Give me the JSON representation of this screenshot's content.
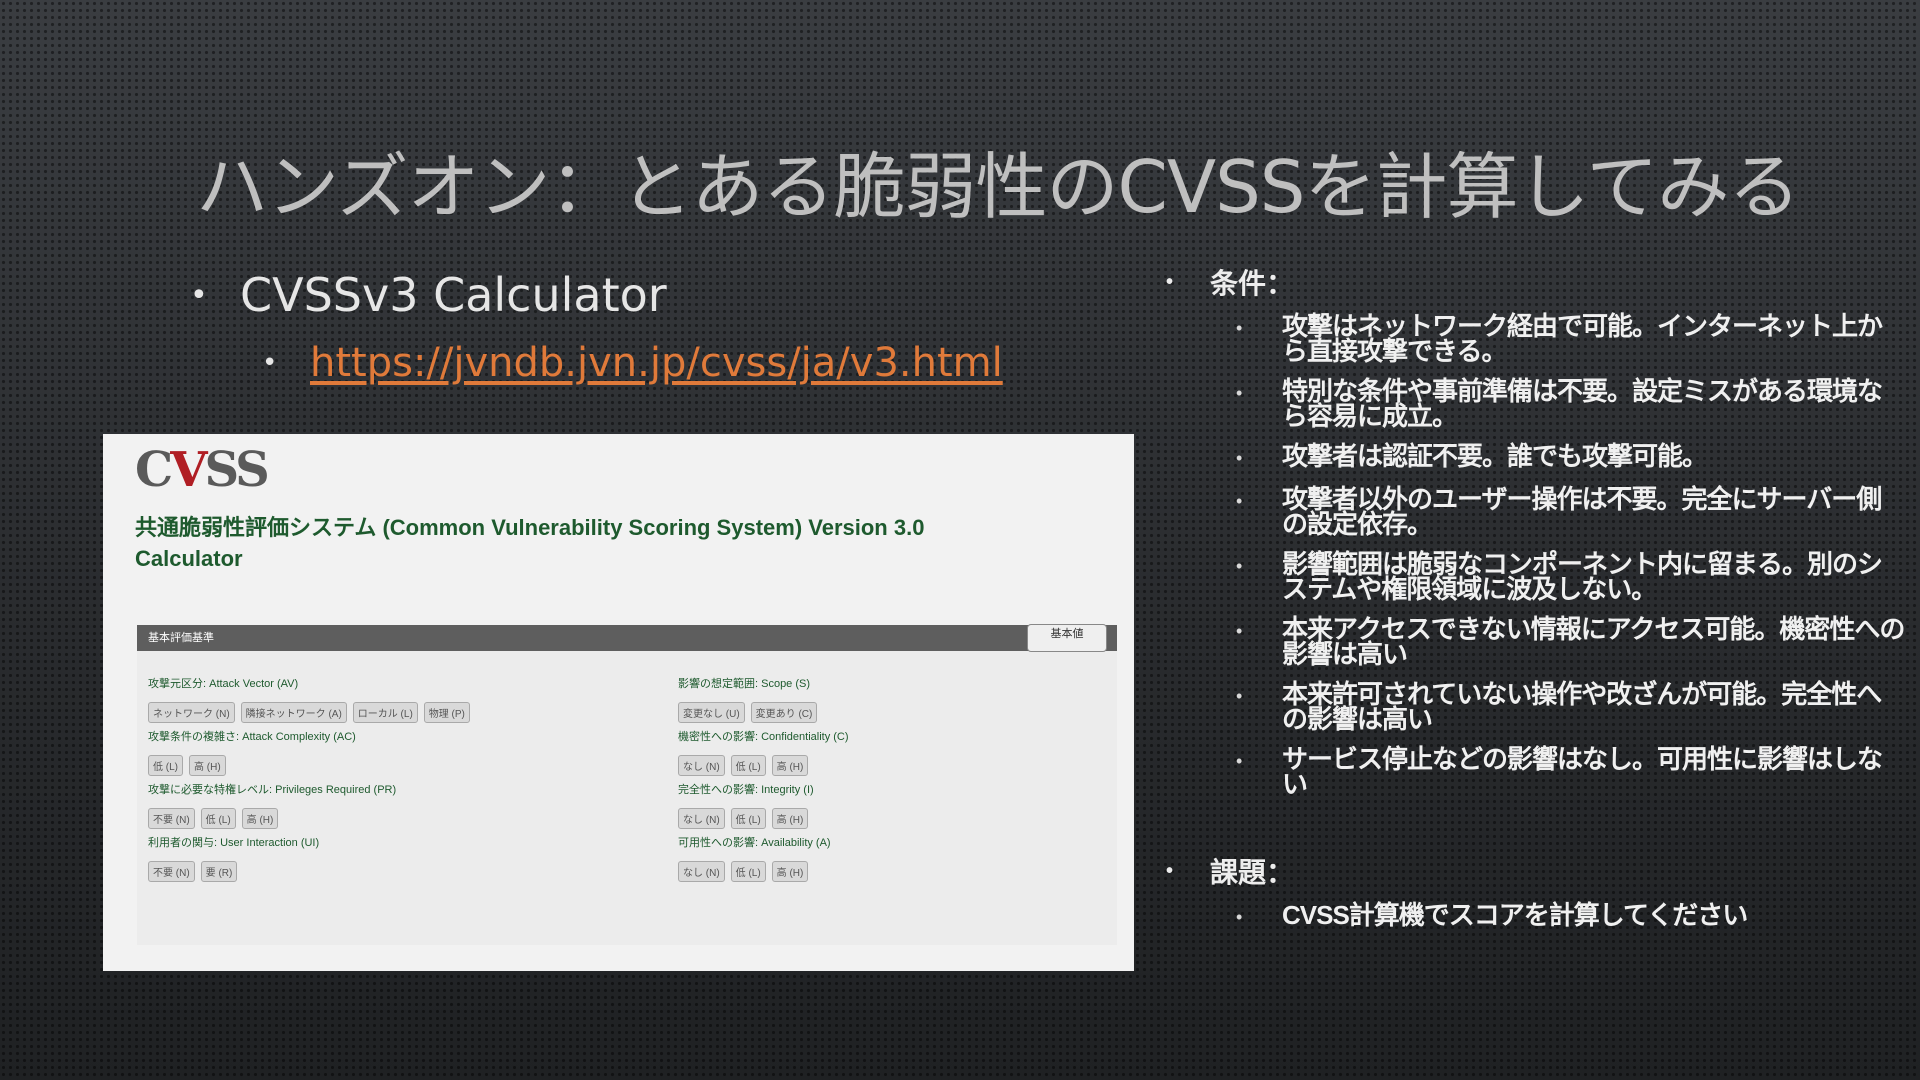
{
  "slide": {
    "title": "ハンズオン：とある脆弱性のCVSSを計算してみる",
    "bullet_main": "CVSSv3 Calculator",
    "bullet_link": "https://jvndb.jvn.jp/cvss/ja/v3.html"
  },
  "screenshot": {
    "logo": {
      "prefix": "C",
      "highlight": "V",
      "suffix": "SS"
    },
    "title": "共通脆弱性評価システム (Common Vulnerability Scoring System) Version 3.0 Calculator",
    "panel_header": "基本評価基準",
    "score_button": "基本値",
    "metrics_left": [
      {
        "label": "攻撃元区分: Attack Vector (AV)",
        "options": [
          "ネットワーク (N)",
          "隣接ネットワーク (A)",
          "ローカル (L)",
          "物理 (P)"
        ]
      },
      {
        "label": "攻撃条件の複雑さ: Attack Complexity (AC)",
        "options": [
          "低 (L)",
          "高 (H)"
        ]
      },
      {
        "label": "攻撃に必要な特権レベル: Privileges Required (PR)",
        "options": [
          "不要 (N)",
          "低 (L)",
          "高 (H)"
        ]
      },
      {
        "label": "利用者の関与: User Interaction (UI)",
        "options": [
          "不要 (N)",
          "要 (R)"
        ]
      }
    ],
    "metrics_right": [
      {
        "label": "影響の想定範囲: Scope (S)",
        "options": [
          "変更なし (U)",
          "変更あり (C)"
        ]
      },
      {
        "label": "機密性への影響: Confidentiality (C)",
        "options": [
          "なし (N)",
          "低 (L)",
          "高 (H)"
        ]
      },
      {
        "label": "完全性への影響: Integrity (I)",
        "options": [
          "なし (N)",
          "低 (L)",
          "高 (H)"
        ]
      },
      {
        "label": "可用性への影響: Availability (A)",
        "options": [
          "なし (N)",
          "低 (L)",
          "高 (H)"
        ]
      }
    ]
  },
  "conditions": {
    "heading": "条件：",
    "items": [
      "攻撃はネットワーク経由で可能。インターネット上から直接攻撃できる。",
      "特別な条件や事前準備は不要。設定ミスがある環境なら容易に成立。",
      "攻撃者は認証不要。誰でも攻撃可能。",
      "攻撃者以外のユーザー操作は不要。完全にサーバー側の設定依存。",
      "影響範囲は脆弱なコンポーネント内に留まる。別のシステムや権限領域に波及しない。",
      "本来アクセスできない情報にアクセス可能。機密性への影響は高い",
      "本来許可されていない操作や改ざんが可能。完全性への影響は高い",
      "サービス停止などの影響はなし。可用性に影響はしない"
    ]
  },
  "task": {
    "heading": "課題：",
    "items": [
      "CVSS計算機でスコアを計算してください"
    ]
  },
  "colors": {
    "link": "#e07a3a",
    "green_text": "#1e5a2e",
    "logo_red": "#b01e24"
  }
}
